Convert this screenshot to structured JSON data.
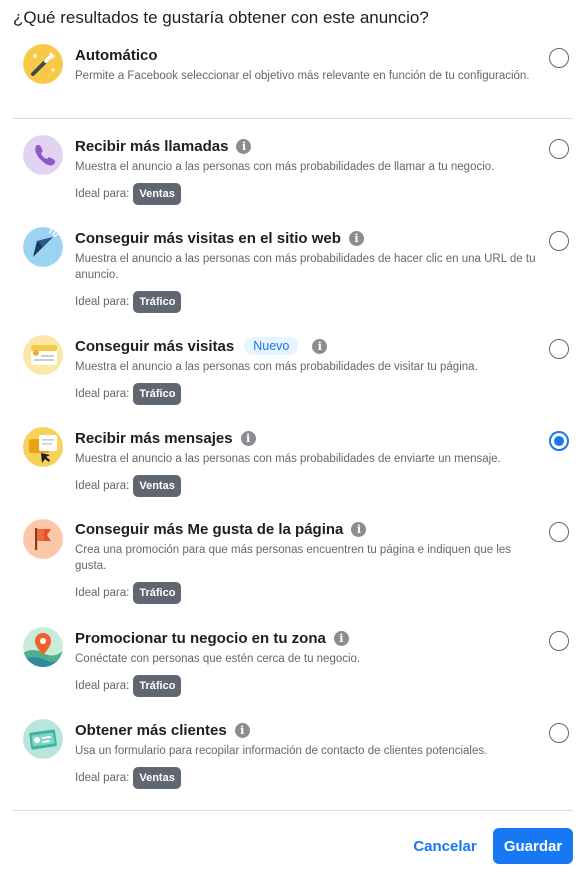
{
  "dialog": {
    "title": "¿Qué resultados te gustaría obtener con este anuncio?",
    "ideal_label": "Ideal para:"
  },
  "options": [
    {
      "icon": "magic-wand-icon",
      "title": "Automático",
      "description": "Permite a Facebook seleccionar el objetivo más relevante en función de tu configuración.",
      "selected": false
    },
    {
      "icon": "phone-icon",
      "title": "Recibir más llamadas",
      "description": "Muestra el anuncio a las personas con más probabilidades de llamar a tu negocio.",
      "tag": "Ventas",
      "selected": false
    },
    {
      "icon": "cursor-click-icon",
      "title": "Conseguir más visitas en el sitio web",
      "description": "Muestra el anuncio a las personas con más probabilidades de hacer clic en una URL de tu anuncio.",
      "tag": "Tráfico",
      "selected": false
    },
    {
      "icon": "page-profile-icon",
      "title": "Conseguir más visitas",
      "badge": "Nuevo",
      "description": "Muestra el anuncio a las personas con más probabilidades de visitar tu página.",
      "tag": "Tráfico",
      "selected": false
    },
    {
      "icon": "messages-icon",
      "title": "Recibir más mensajes",
      "description": "Muestra el anuncio a las personas con más probabilidades de enviarte un mensaje.",
      "tag": "Ventas",
      "selected": true
    },
    {
      "icon": "flag-icon",
      "title": "Conseguir más Me gusta de la página",
      "description": "Crea una promoción para que más personas encuentren tu página e indiquen que les gusta.",
      "tag": "Tráfico",
      "selected": false
    },
    {
      "icon": "location-pin-icon",
      "title": "Promocionar tu negocio en tu zona",
      "description": "Conéctate con personas que estén cerca de tu negocio.",
      "tag": "Tráfico",
      "selected": false
    },
    {
      "icon": "contact-card-icon",
      "title": "Obtener más clientes",
      "description": "Usa un formulario para recopilar información de contacto de clientes potenciales.",
      "tag": "Ventas",
      "selected": false
    }
  ],
  "footer": {
    "cancel_label": "Cancelar",
    "save_label": "Guardar"
  },
  "colors": {
    "accent": "#1877f2",
    "tag_bg": "#606770",
    "divider": "#dadde1"
  }
}
